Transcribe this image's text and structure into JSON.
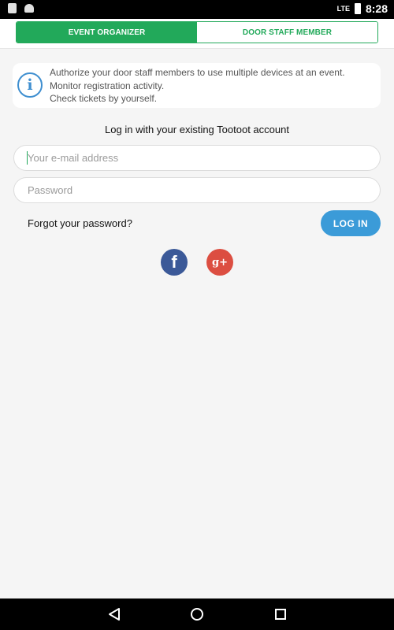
{
  "status_bar": {
    "time": "8:28",
    "network": "LTE",
    "icons": [
      "sd-card-icon",
      "android-icon",
      "signal-icon",
      "battery-icon"
    ]
  },
  "tabs": [
    {
      "label": "EVENT ORGANIZER",
      "active": true
    },
    {
      "label": "DOOR STAFF MEMBER",
      "active": false
    }
  ],
  "info": {
    "icon": "info-icon",
    "lines": [
      "Authorize your door staff members to use multiple devices at an event.",
      "Monitor registration activity.",
      "Check tickets by yourself."
    ]
  },
  "login": {
    "title": "Log in with your existing Tootoot account",
    "email_placeholder": "Your e-mail address",
    "email_value": "",
    "password_placeholder": "Password",
    "password_value": "",
    "forgot_label": "Forgot your password?",
    "button_label": "LOG IN"
  },
  "social": {
    "facebook_glyph": "f",
    "google_glyph": "g+"
  },
  "colors": {
    "accent_green": "#22a95a",
    "button_blue": "#3b9bd8",
    "facebook": "#3b5998",
    "google": "#dc4e41",
    "background": "#f5f5f5"
  },
  "nav_bar": {
    "buttons": [
      "back-icon",
      "home-icon",
      "recent-apps-icon"
    ]
  }
}
